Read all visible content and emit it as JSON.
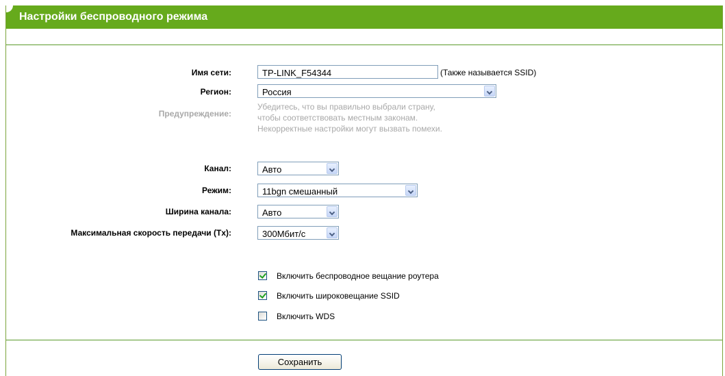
{
  "page": {
    "title": "Настройки беспроводного режима"
  },
  "form": {
    "ssid": {
      "label": "Имя сети:",
      "value": "TP-LINK_F54344",
      "note": "(Также называется SSID)"
    },
    "region": {
      "label": "Регион:",
      "value": "Россия"
    },
    "warning": {
      "label": "Предупреждение:",
      "lines": [
        "Убедитесь, что вы правильно выбрали страну,",
        "чтобы соответствовать местным законам.",
        "Некорректные настройки могут вызвать помехи."
      ]
    },
    "channel": {
      "label": "Канал:",
      "value": "Авто"
    },
    "mode": {
      "label": "Режим:",
      "value": "11bgn смешанный"
    },
    "channel_width": {
      "label": "Ширина канала:",
      "value": "Авто"
    },
    "max_tx_rate": {
      "label": "Максимальная скорость передачи (Tx):",
      "value": "300Мбит/с"
    },
    "checkboxes": [
      {
        "label": "Включить беспроводное вещание роутера",
        "checked": true
      },
      {
        "label": "Включить широковещание SSID",
        "checked": true
      },
      {
        "label": "Включить WDS",
        "checked": false
      }
    ],
    "save_label": "Сохранить"
  },
  "colors": {
    "title_bar": "#66aa1c",
    "divider": "#5a9a2a",
    "warning_text": "#a8a8a8",
    "checkmark": "#21a121"
  }
}
